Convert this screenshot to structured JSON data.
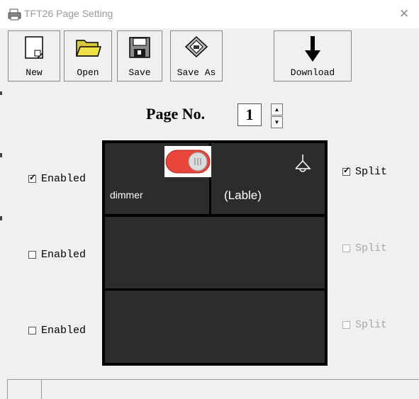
{
  "window": {
    "title": "TFT26 Page Setting",
    "close_glyph": "×"
  },
  "toolbar": {
    "new_label": "New",
    "open_label": "Open",
    "save_label": "Save",
    "save_as_label": "Save As",
    "download_label": "Download"
  },
  "page_number": {
    "label": "Page No.",
    "value": "1"
  },
  "rows": [
    {
      "enabled_label": "Enabled",
      "enabled_checked": true,
      "split_label": "Split",
      "split_checked": true,
      "split_active": true
    },
    {
      "enabled_label": "Enabled",
      "enabled_checked": false,
      "split_label": "Split",
      "split_checked": false,
      "split_active": false
    },
    {
      "enabled_label": "Enabled",
      "enabled_checked": false,
      "split_label": "Split",
      "split_checked": false,
      "split_active": false
    }
  ],
  "panel": {
    "cell_1_label": "dimmer",
    "cell_2_label": "(Lable)",
    "toggle_state": "on",
    "colors": {
      "cell_bg": "#2c2c2c",
      "border": "#000000",
      "toggle_red": "#e8463a"
    }
  }
}
